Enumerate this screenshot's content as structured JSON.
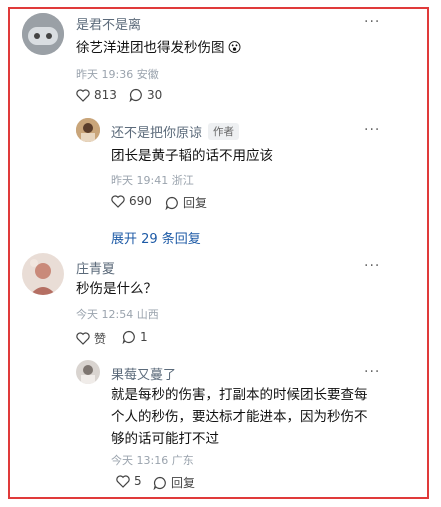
{
  "comments": [
    {
      "username": "是君不是离",
      "text": "徐艺洋进团也得发秒伤图",
      "emoji": "😮",
      "meta": "昨天 19:36 安徽",
      "likes": "813",
      "replies": "30",
      "more": "···",
      "reply": {
        "username": "还不是把你原谅",
        "author_tag": "作者",
        "text": "团长是黄子韬的话不用应该",
        "meta": "昨天 19:41 浙江",
        "likes": "690",
        "reply_label": "回复",
        "more": "···"
      },
      "expand_label": "展开 29 条回复"
    },
    {
      "username": "庄青夏",
      "text": "秒伤是什么？",
      "meta": "今天 12:54 山西",
      "like_label": "赞",
      "replies": "1",
      "more": "···",
      "reply": {
        "username": "果莓又蔓了",
        "text_lines": [
          "就是每秒的伤害，打副本的时候团长要查每",
          "个人的秒伤，要达标才能进本，因为秒伤不",
          "够的话可能打不过"
        ],
        "meta": "今天 13:16 广东",
        "likes": "5",
        "reply_label": "回复",
        "more": "···"
      }
    }
  ],
  "colors": {
    "border": "#e03a3a",
    "link": "#1d5aa6"
  }
}
